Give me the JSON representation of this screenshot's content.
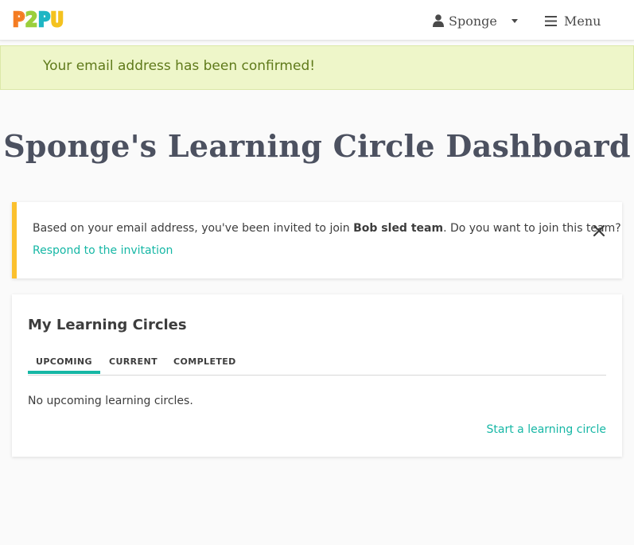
{
  "header": {
    "logo": [
      "P",
      "2",
      "P",
      "U"
    ],
    "user_name": "Sponge",
    "menu_label": "Menu"
  },
  "alert": {
    "message": "Your email address has been confirmed!"
  },
  "page": {
    "title": "Sponge's Learning Circle Dashboard"
  },
  "invitation": {
    "text_before": "Based on your email address, you've been invited to join ",
    "team_name": "Bob sled team",
    "text_after": ". Do you want to join this team?",
    "respond_link": "Respond to the invitation"
  },
  "learning_circles": {
    "title": "My Learning Circles",
    "tabs": [
      {
        "label": "UPCOMING",
        "active": true
      },
      {
        "label": "CURRENT",
        "active": false
      },
      {
        "label": "COMPLETED",
        "active": false
      }
    ],
    "empty_message": "No upcoming learning circles.",
    "start_link": "Start a learning circle"
  },
  "colors": {
    "accent": "#16b7a5",
    "warning_border": "#fbc02d",
    "success_bg": "#eef6c9",
    "success_text": "#5f7a1a"
  }
}
